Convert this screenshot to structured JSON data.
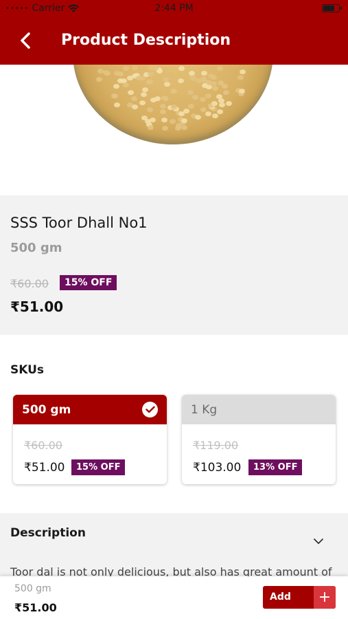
{
  "status_bar": {
    "carrier": "Carrier",
    "time": "2:44 PM"
  },
  "header": {
    "title": "Product Description"
  },
  "product": {
    "name": "SSS Toor Dhall No1",
    "weight": "500 gm",
    "mrp": "₹60.00",
    "discount": "15% OFF",
    "price": "₹51.00"
  },
  "skus": {
    "title": "SKUs",
    "items": [
      {
        "label": "500 gm",
        "mrp": "₹60.00",
        "price": "₹51.00",
        "discount": "15% OFF",
        "selected": true
      },
      {
        "label": "1 Kg",
        "mrp": "₹119.00",
        "price": "₹103.00",
        "discount": "13% OFF",
        "selected": false
      }
    ]
  },
  "description": {
    "title": "Description",
    "text": "Toor dal is not only delicious, but also has great amount of"
  },
  "bottom_bar": {
    "weight": "500 gm",
    "price": "₹51.00",
    "add_label": "Add",
    "plus_label": "+"
  },
  "colors": {
    "brand": "#a50000",
    "discount_badge": "#6d0f5e",
    "plus_button": "#d8363c"
  }
}
